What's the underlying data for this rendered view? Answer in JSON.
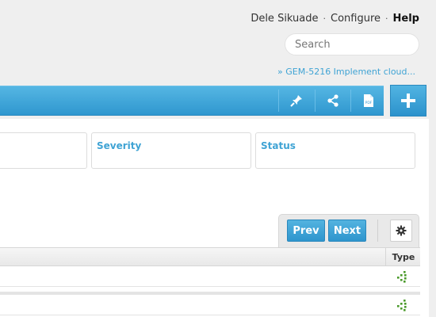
{
  "header": {
    "user_name": "Dele Sikuade",
    "separator": "·",
    "configure": "Configure",
    "help": "Help",
    "search_placeholder": "Search",
    "breadcrumb": "» GEM-5216 Implement cloud..."
  },
  "toolbar": {
    "icons": [
      "pin-icon",
      "share-icon",
      "pdf-icon"
    ],
    "pdf_text": "PDF",
    "add_icon": "plus-icon",
    "color": "#3aa4d8"
  },
  "fields": {
    "severity": "Severity",
    "status": "Status"
  },
  "pager": {
    "prev": "Prev",
    "next": "Next",
    "settings_icon": "gear-icon"
  },
  "table": {
    "columns": [
      "Type"
    ],
    "rows": [
      {
        "type_icon": "item-type-icon"
      },
      {
        "type_icon": "item-type-icon"
      }
    ]
  },
  "colors": {
    "accent": "#3aa4d8",
    "link": "#3fa3d4",
    "type_icon": "#4a9a2a"
  }
}
